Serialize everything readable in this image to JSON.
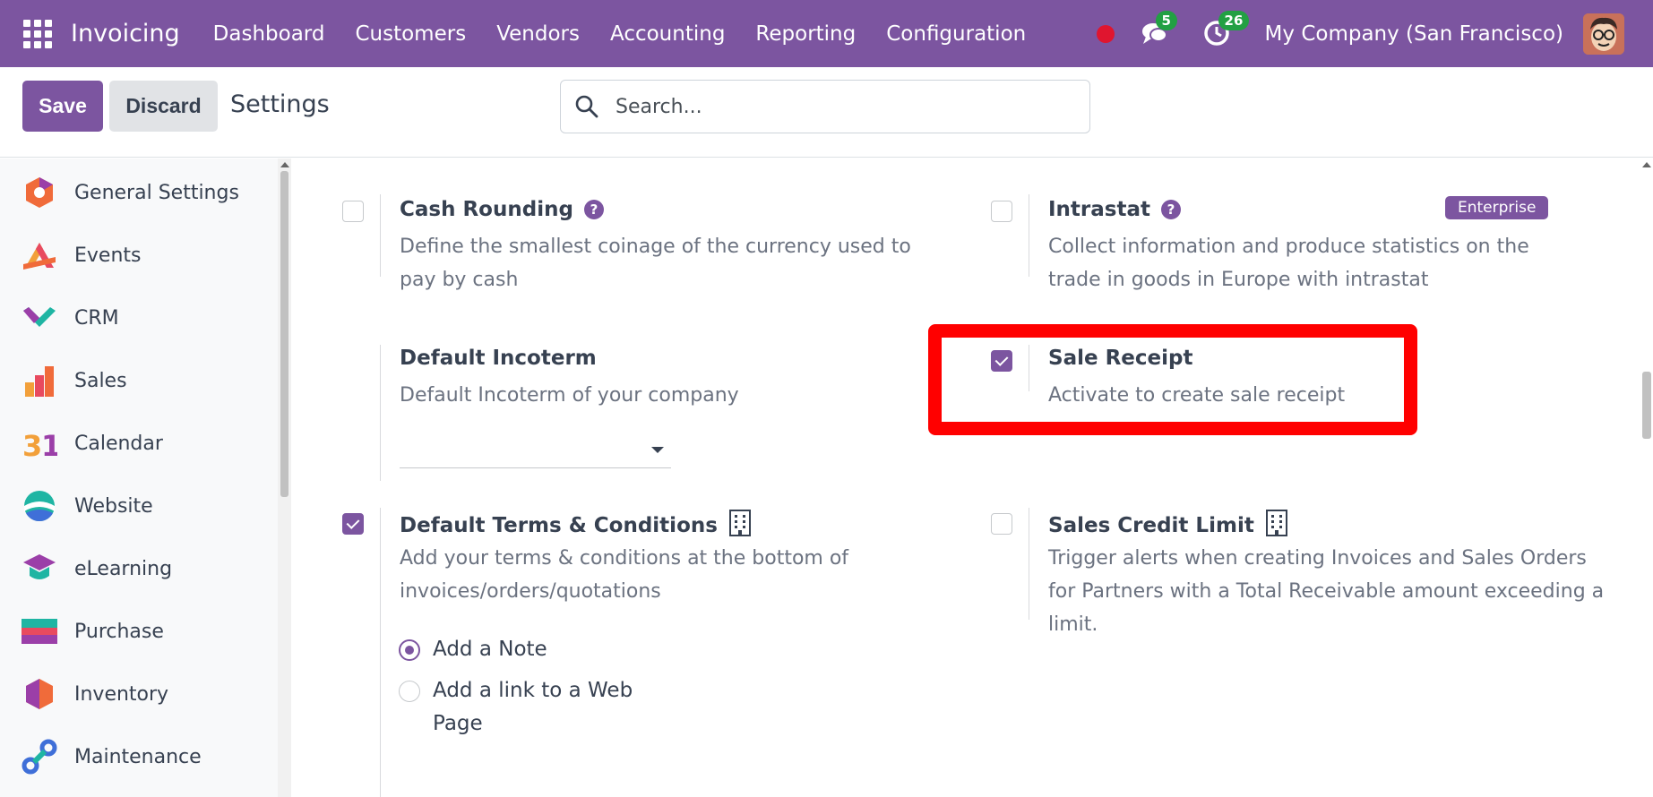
{
  "app": {
    "name": "Invoicing",
    "menu": [
      "Dashboard",
      "Customers",
      "Vendors",
      "Accounting",
      "Reporting",
      "Configuration"
    ],
    "messages_count": "5",
    "activities_count": "26",
    "company": "My Company (San Francisco)"
  },
  "control": {
    "save_label": "Save",
    "discard_label": "Discard",
    "title": "Settings",
    "search_placeholder": "Search..."
  },
  "sidebar": {
    "items": [
      {
        "label": "General Settings",
        "icon": "general-settings-icon"
      },
      {
        "label": "Events",
        "icon": "events-icon"
      },
      {
        "label": "CRM",
        "icon": "crm-icon"
      },
      {
        "label": "Sales",
        "icon": "sales-icon"
      },
      {
        "label": "Calendar",
        "icon": "calendar-icon"
      },
      {
        "label": "Website",
        "icon": "website-icon"
      },
      {
        "label": "eLearning",
        "icon": "elearning-icon"
      },
      {
        "label": "Purchase",
        "icon": "purchase-icon"
      },
      {
        "label": "Inventory",
        "icon": "inventory-icon"
      },
      {
        "label": "Maintenance",
        "icon": "maintenance-icon"
      }
    ]
  },
  "settings": {
    "cash_rounding": {
      "title": "Cash Rounding",
      "desc": "Define the smallest coinage of the currency used to pay by cash",
      "checked": false
    },
    "intrastat": {
      "title": "Intrastat",
      "desc": "Collect information and produce statistics on the trade in goods in Europe with intrastat",
      "checked": false,
      "badge": "Enterprise"
    },
    "default_incoterm": {
      "title": "Default Incoterm",
      "desc": "Default Incoterm of your company",
      "value": ""
    },
    "sale_receipt": {
      "title": "Sale Receipt",
      "desc": "Activate to create sale receipt",
      "checked": true
    },
    "default_terms": {
      "title": "Default Terms & Conditions",
      "desc": "Add your terms & conditions at the bottom of invoices/orders/quotations",
      "checked": true,
      "options": [
        {
          "label": "Add a Note",
          "selected": true
        },
        {
          "label": "Add a link to a Web Page",
          "selected": false
        }
      ]
    },
    "sales_credit_limit": {
      "title": "Sales Credit Limit",
      "desc": "Trigger alerts when creating Invoices and Sales Orders for Partners with a Total Receivable amount exceeding a limit.",
      "checked": false
    }
  },
  "colors": {
    "brand": "#7c55a0",
    "highlight": "#ff0000",
    "badge_green": "#22a043"
  }
}
